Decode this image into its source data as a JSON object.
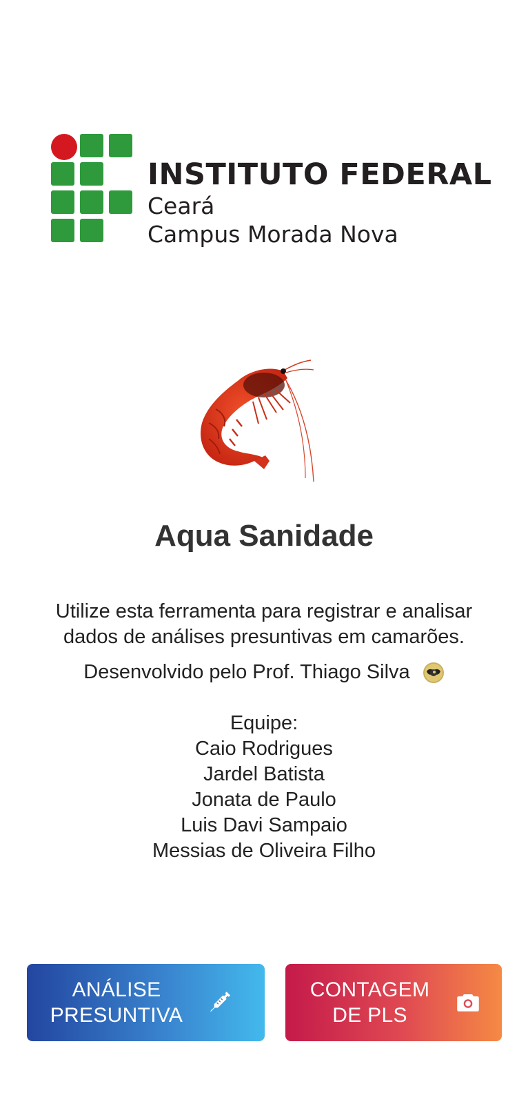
{
  "logo": {
    "title": "INSTITUTO FEDERAL",
    "line1": "Ceará",
    "line2": "Campus Morada Nova",
    "green": "#2e9a3c",
    "red": "#d4181f"
  },
  "app": {
    "title": "Aqua Sanidade",
    "description": "Utilize esta ferramenta para registrar e analisar dados de análises presuntivas em camarões.",
    "developer": "Desenvolvido pelo Prof. Thiago Silva",
    "developer_icon": "sunglasses-emoji-icon"
  },
  "team": {
    "label": "Equipe:",
    "members": [
      "Caio Rodrigues",
      "Jardel Batista",
      "Jonata de Paulo",
      "Luis Davi Sampaio",
      "Messias de Oliveira Filho"
    ]
  },
  "buttons": {
    "analysis": {
      "line1": "ANÁLISE",
      "line2": "PRESUNTIVA",
      "icon": "syringe-icon"
    },
    "count": {
      "line1": "CONTAGEM",
      "line2": "DE PLS",
      "icon": "camera-icon"
    }
  }
}
